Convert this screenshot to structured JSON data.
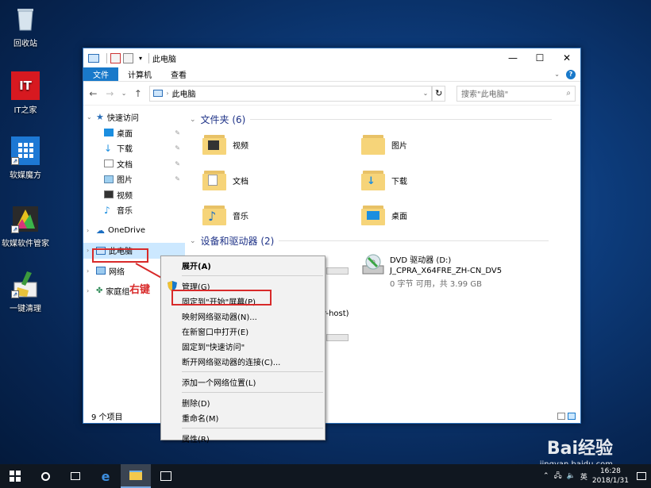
{
  "desktop": {
    "icons": [
      {
        "label": "回收站"
      },
      {
        "label": "IT之家",
        "text": "IT"
      },
      {
        "label": "软媒魔方"
      },
      {
        "label": "软媒软件管家"
      },
      {
        "label": "一键清理"
      }
    ]
  },
  "window": {
    "title": "此电脑",
    "controls": {
      "minimize": "—",
      "maximize": "☐",
      "close": "✕"
    },
    "ribbon_tabs": [
      "文件",
      "计算机",
      "查看"
    ],
    "help": "?",
    "address": {
      "path": "此电脑",
      "back": "←",
      "forward": "→",
      "up": "↑",
      "refresh": "↻"
    },
    "search": {
      "placeholder": "搜索\"此电脑\""
    },
    "nav": {
      "quick_access": "快速访问",
      "quick_items": [
        "桌面",
        "下载",
        "文档",
        "图片",
        "视频",
        "音乐"
      ],
      "onedrive": "OneDrive",
      "this_pc": "此电脑",
      "network": "网络",
      "homegroup": "家庭组"
    },
    "folders_header": "文件夹 (6)",
    "folders": [
      "视频",
      "图片",
      "文档",
      "下载",
      "音乐",
      "桌面"
    ],
    "devices_header": "设备和驱动器 (2)",
    "drive": {
      "name": "DVD 驱动器 (D:)",
      "label": "J_CPRA_X64FRE_ZH-CN_DV5",
      "space": "0 字节 可用，共 3.99 GB"
    },
    "partial_text": "r-host)",
    "status": "9 个项目"
  },
  "context_menu": {
    "items": [
      "展开(A)",
      "管理(G)",
      "固定到\"开始\"屏幕(P)",
      "映射网络驱动器(N)...",
      "在新窗口中打开(E)",
      "固定到\"快速访问\"",
      "断开网络驱动器的连接(C)...",
      "添加一个网络位置(L)",
      "删除(D)",
      "重命名(M)",
      "属性(R)"
    ]
  },
  "annotation": {
    "label": "右键"
  },
  "taskbar": {
    "time": "16:28",
    "date": "2018/1/31",
    "ime": "英"
  },
  "watermark": {
    "brand": "Bai经验",
    "url": "jingyan.baidu.com"
  }
}
